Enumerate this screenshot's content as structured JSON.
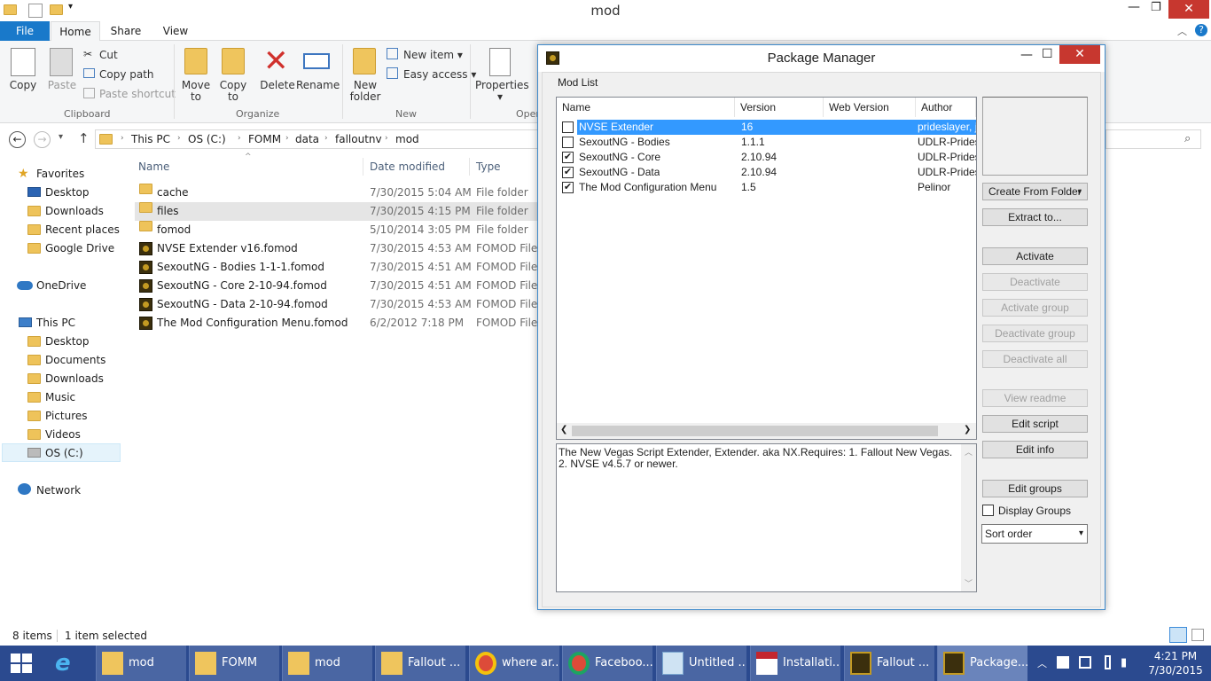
{
  "window": {
    "title": "mod"
  },
  "ribbon_tabs": {
    "file": "File",
    "home": "Home",
    "share": "Share",
    "view": "View"
  },
  "clipboard": {
    "copy": "Copy",
    "paste": "Paste",
    "cut": "Cut",
    "copy_path": "Copy path",
    "paste_shortcut": "Paste shortcut",
    "group": "Clipboard"
  },
  "organize": {
    "move_to_1": "Move",
    "move_to_2": "to",
    "copy_to_1": "Copy",
    "copy_to_2": "to",
    "delete": "Delete",
    "rename": "Rename",
    "group": "Organize"
  },
  "new_group": {
    "new_folder_1": "New",
    "new_folder_2": "folder",
    "new_item": "New item",
    "easy_access": "Easy access",
    "group": "New"
  },
  "open_group": {
    "properties": "Properties",
    "group": "Open"
  },
  "breadcrumb": [
    "This PC",
    "OS (C:)",
    "FOMM",
    "data",
    "falloutnv",
    "mod"
  ],
  "nav": {
    "favorites": "Favorites",
    "fav_items": [
      "Desktop",
      "Downloads",
      "Recent places",
      "Google Drive"
    ],
    "onedrive": "OneDrive",
    "thispc": "This PC",
    "pc_items": [
      "Desktop",
      "Documents",
      "Downloads",
      "Music",
      "Pictures",
      "Videos",
      "OS (C:)"
    ],
    "network": "Network"
  },
  "columns": {
    "name": "Name",
    "date": "Date modified",
    "type": "Type"
  },
  "files": [
    {
      "name": "cache",
      "date": "7/30/2015 5:04 AM",
      "type": "File folder"
    },
    {
      "name": "files",
      "date": "7/30/2015 4:15 PM",
      "type": "File folder"
    },
    {
      "name": "fomod",
      "date": "5/10/2014 3:05 PM",
      "type": "File folder"
    },
    {
      "name": "NVSE Extender v16.fomod",
      "date": "7/30/2015 4:53 AM",
      "type": "FOMOD File"
    },
    {
      "name": "SexoutNG - Bodies 1-1-1.fomod",
      "date": "7/30/2015 4:51 AM",
      "type": "FOMOD File"
    },
    {
      "name": "SexoutNG - Core 2-10-94.fomod",
      "date": "7/30/2015 4:51 AM",
      "type": "FOMOD File"
    },
    {
      "name": "SexoutNG - Data 2-10-94.fomod",
      "date": "7/30/2015 4:53 AM",
      "type": "FOMOD File"
    },
    {
      "name": "The Mod Configuration Menu.fomod",
      "date": "6/2/2012 7:18 PM",
      "type": "FOMOD File"
    }
  ],
  "status": {
    "items": "8 items",
    "selected": "1 item selected"
  },
  "package_manager": {
    "title": "Package Manager",
    "mod_list_label": "Mod List",
    "columns": {
      "name": "Name",
      "version": "Version",
      "web_version": "Web Version",
      "author": "Author"
    },
    "mods": [
      {
        "name": "NVSE Extender",
        "version": "16",
        "author": "prideslayer, ja",
        "checked": "",
        "selected": true
      },
      {
        "name": "SexoutNG - Bodies",
        "version": "1.1.1",
        "author": "UDLR-Pridesl",
        "checked": ""
      },
      {
        "name": "SexoutNG - Core",
        "version": "2.10.94",
        "author": "UDLR-Pridesl",
        "checked": "✔"
      },
      {
        "name": "SexoutNG - Data",
        "version": "2.10.94",
        "author": "UDLR-Pridesl",
        "checked": "✔"
      },
      {
        "name": "The Mod Configuration Menu",
        "version": "1.5",
        "author": "Pelinor",
        "checked": "✔"
      }
    ],
    "description": "The New Vegas Script Extender, Extender.  aka NX.Requires:  1. Fallout New Vegas.  2. NVSE v4.5.7 or newer.",
    "buttons": {
      "create_from_folder": "Create From Folder",
      "extract_to": "Extract to...",
      "activate": "Activate",
      "deactivate": "Deactivate",
      "activate_group": "Activate group",
      "deactivate_group": "Deactivate group",
      "deactivate_all": "Deactivate all",
      "view_readme": "View readme",
      "edit_script": "Edit script",
      "edit_info": "Edit info",
      "edit_groups": "Edit groups"
    },
    "display_groups": "Display Groups",
    "sort_order": "Sort order"
  },
  "taskbar": {
    "items": [
      "mod",
      "FOMM",
      "mod",
      "Fallout ...",
      "where ar...",
      "Faceboo...",
      "Untitled ...",
      "Installati...",
      "Fallout ...",
      "Package..."
    ],
    "time": "4:21 PM",
    "date": "7/30/2015"
  },
  "colors": {
    "accent": "#1979ca",
    "selection": "#3399ff",
    "taskbar": "#2b4a8f"
  }
}
